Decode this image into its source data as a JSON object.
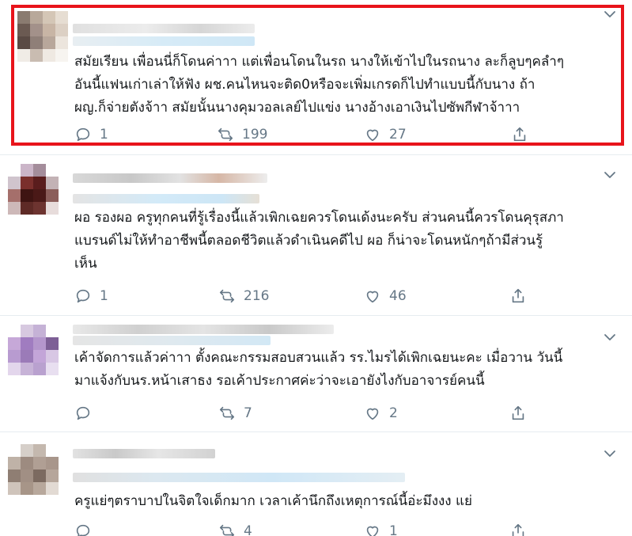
{
  "tweets": [
    {
      "text": "สมัยเรียน เพื่อนนี่ก็โดนค่าาา แต่เพื่อนโดนในรถ นางให้เข้าไปในรถนาง ละก็ลูบๆคลำๆ\nอันนี้แฟนเก่าเล่าให้ฟัง ผช.คนไหนจะติด0หรือจะเพิ่มเกรดก็ไปทำแบบนี้กับนาง ถ้า\nผญ.ก็จ่ายตังจ้าา สมัยนั้นนางคุมวอลเลย์ไปแข่ง นางอ้างเอาเงินไปซัพกีฬาจ้าาา",
      "replies": "1",
      "retweets": "199",
      "likes": "27",
      "highlighted": true
    },
    {
      "text": "ผอ รองผอ ครูทุกคนที่รู้เรื่องนี้แล้วเพิกเฉยควรโดนเด้งนะครับ ส่วนคนนี้ควรโดนคุรุสภา\nแบรนด์ไม่ให้ทำอาชีพนี้ตลอดชีวิตแล้วดำเนินคดีไป ผอ ก็น่าจะโดนหนักๆถ้ามีส่วนรู้\nเห็น",
      "replies": "1",
      "retweets": "216",
      "likes": "46",
      "highlighted": false
    },
    {
      "text": "เค้าจัดการแล้วค่าาา ตั้งคณะกรรมสอบสวนแล้ว รร.ไมรได้เพิกเฉยนะคะ เมื่อวาน วันนี้\nมาแจ้งกับนร.หน้าเสาธง รอเค้าประกาศค่ะว่าจะเอายังไงกับอาจารย์คนนี้",
      "replies": "",
      "retweets": "7",
      "likes": "2",
      "highlighted": false
    },
    {
      "text": "ครูแย่ๆตราบาปในจิตใจเด็กมาก เวลาเค้านึกถึงเหตุการณ์นี้อ่ะมึงงง แย่",
      "replies": "",
      "retweets": "4",
      "likes": "1",
      "highlighted": false
    }
  ],
  "icons": {
    "reply": "reply-icon",
    "retweet": "retweet-icon",
    "like": "heart-icon",
    "share": "share-icon",
    "menu": "chevron-down-icon"
  },
  "colors": {
    "highlight_border": "#e8141b",
    "icon_gray": "#657786",
    "divider": "#e6ecf0"
  }
}
